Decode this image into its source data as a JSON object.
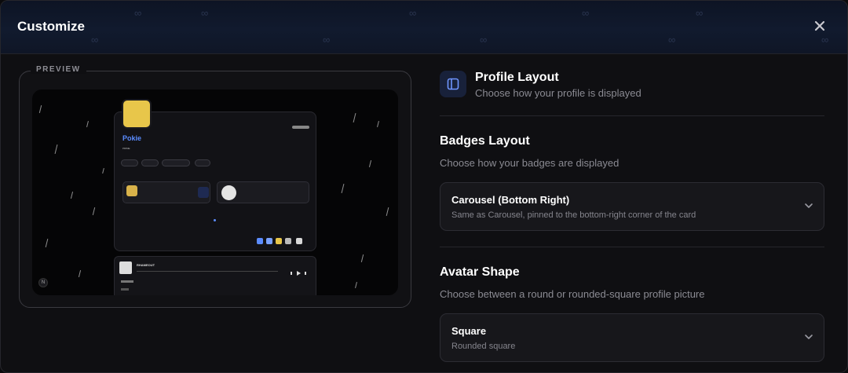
{
  "modal": {
    "title": "Customize"
  },
  "preview": {
    "label": "PREVIEW",
    "card_name": "Pokie",
    "card_subtitle": "PRIME",
    "music_title": "RHAMEOUT",
    "corner_badge": "N"
  },
  "profile_layout": {
    "title": "Profile Layout",
    "description": "Choose how your profile is displayed",
    "icon": "layout-sidebar-icon"
  },
  "badges_layout": {
    "title": "Badges Layout",
    "description": "Choose how your badges are displayed",
    "selected_value": "Carousel (Bottom Right)",
    "selected_description": "Same as Carousel, pinned to the bottom-right corner of the card"
  },
  "avatar_shape": {
    "title": "Avatar Shape",
    "description": "Choose between a round or rounded-square profile picture",
    "selected_value": "Square",
    "selected_description": "Rounded square"
  },
  "colors": {
    "accent": "#5b8cff",
    "background": "#0f0f12",
    "header_bg": "#111a2e",
    "panel": "#17171b"
  }
}
